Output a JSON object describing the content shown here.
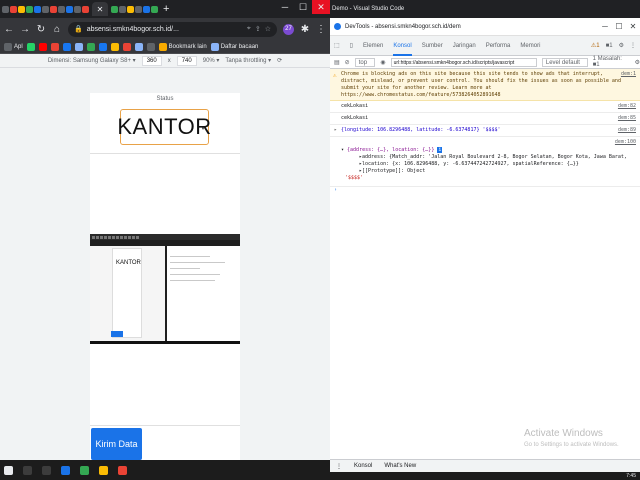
{
  "chrome": {
    "address": "absensi.smkn4bogor.sch.id/...",
    "profile_count": "27",
    "bookmarks": [
      {
        "label": "Apl",
        "color": "#5f6368"
      },
      {
        "label": "Bookmark lain",
        "color": "#f9ab00"
      },
      {
        "label": "Daftar bacaan",
        "color": "#8ab4f8"
      }
    ],
    "device_bar": {
      "device": "Dimensi: Samsung Galaxy S8+ ▾",
      "width": "360",
      "times": "x",
      "height": "740",
      "zoom": "90% ▾",
      "throttle": "Tanpa throttling ▾"
    }
  },
  "page": {
    "status_label": "Status",
    "status_value": "KANTOR",
    "camera_preview_text": "KANTOR",
    "send_button": "Kirim Data"
  },
  "devtools": {
    "window_title": "Demo - Visual Studio Code",
    "title": "DevTools - absensi.smkn4bogor.sch.id/dem",
    "tabs": [
      "Elemen",
      "Konsol",
      "Sumber",
      "Jaringan",
      "Performa",
      "Memori"
    ],
    "active_tab": "Konsol",
    "warn_badge": "⚠1",
    "info_badge": "■1",
    "context": "top ▾",
    "filter_value": "url:https://absensi.smkn4bogor.sch.id/scripts/javascript",
    "level": "Level default ▾",
    "issues": "1 Masalah: ■1",
    "warning_message": "Chrome is blocking ads on this site because this site tends to show ads that interrupt, distract, mislead, or prevent user control. You should fix the issues as soon as possible and submit your site for another review. Learn more at https://www.chromestatus.com/feature/5738264052891648",
    "warning_source": "dem:1",
    "logs": [
      {
        "text": "cekLokasi",
        "source": "dem:82"
      },
      {
        "text": "cekLokasi",
        "source": "dem:85"
      },
      {
        "text": "{longitude: 106.8296488, latitude: -6.6374817} '$$$$'",
        "source": "dem:89"
      },
      {
        "text": "",
        "source": "dem:100"
      }
    ],
    "object_head": "{address: {…}, location: {…}}",
    "object_lines": [
      "▸address: {Match_addr: 'Jalan Royal Boulevard 2-8, Bogor Selatan, Bogor Kota, Jawa Barat, 161…",
      "▸location: {x: 106.8296488, y: -6.637447242724927, spatialReference: {…}}",
      "▸[[Prototype]]: Object"
    ],
    "object_tail": "'$$$$'",
    "drawer_tabs": [
      "Konsol",
      "What's New"
    ]
  },
  "system": {
    "watermark_title": "Activate Windows",
    "watermark_sub": "Go to Settings to activate Windows.",
    "clock": "7:45"
  }
}
